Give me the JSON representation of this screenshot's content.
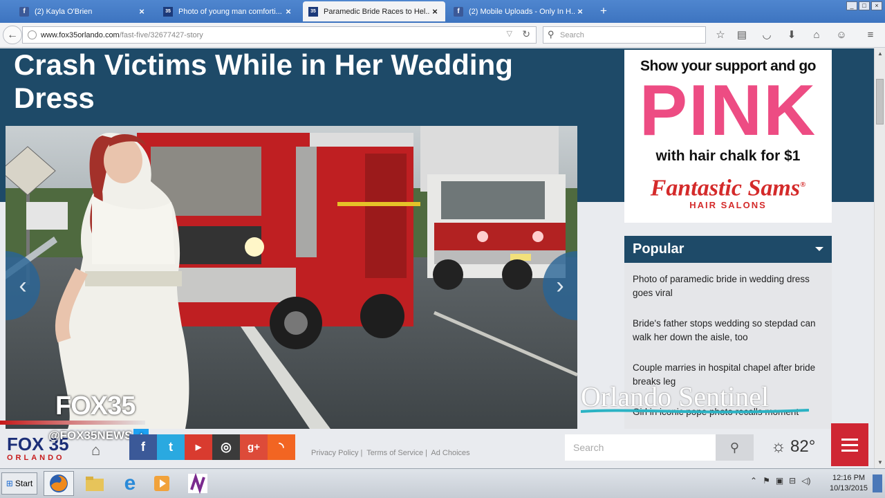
{
  "browser": {
    "tabs": [
      {
        "label": "(2) Kayla O'Brien",
        "favicon": "facebook-icon",
        "active": false
      },
      {
        "label": "Photo of young man comforti...",
        "favicon": "fox35-icon",
        "active": false
      },
      {
        "label": "Paramedic Bride Races to Hel...",
        "favicon": "fox35-icon",
        "active": true
      },
      {
        "label": "(2) Mobile Uploads - Only In H...",
        "favicon": "facebook-icon",
        "active": false
      }
    ],
    "new_tab_label": "+",
    "url_host": "www.fox35orlando.com",
    "url_path": "/fast-five/32677427-story",
    "search_placeholder": "Search"
  },
  "article": {
    "headline": "Crash Victims While in Her Wedding Dress"
  },
  "watermark": {
    "fox35": "FOX35",
    "handle": "@FOX35NEWS"
  },
  "ad": {
    "line1": "Show your support and go",
    "big": "PINK",
    "line2": "with hair chalk for $1",
    "brand": "Fantastic Sams",
    "registered": "®",
    "tagline": "HAIR SALONS"
  },
  "popular": {
    "title": "Popular",
    "items": [
      "Photo of paramedic bride in wedding dress goes viral",
      "Bride's father stops wedding so stepdad can walk her down the aisle, too",
      "Couple marries in hospital chapel after bride breaks leg",
      "Girl in iconic pope photo recalls moment"
    ]
  },
  "sentinel": "Orlando Sentinel",
  "footer": {
    "logo_top": "FOX 35",
    "logo_bottom": "ORLANDO",
    "links": [
      "Privacy Policy",
      "Terms of Service",
      "Ad Choices"
    ],
    "search_placeholder": "Search",
    "temperature": "82°"
  },
  "taskbar": {
    "start": "Start",
    "time": "12:16 PM",
    "date": "10/13/2015"
  },
  "colors": {
    "brand_blue": "#1e4a68",
    "ad_pink": "#ed4c83",
    "fox_red": "#cf2633"
  }
}
